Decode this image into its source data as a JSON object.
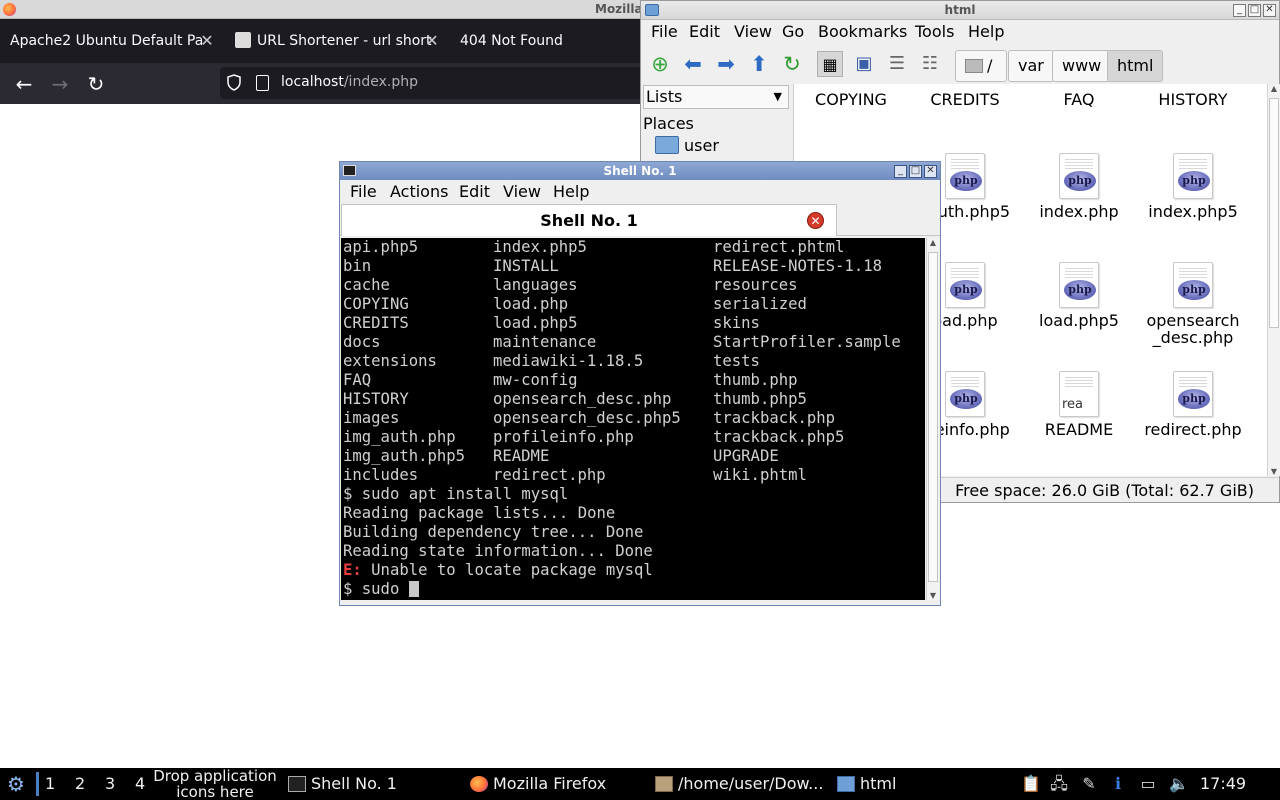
{
  "firefox": {
    "window_title": "Mozilla",
    "tabs": [
      {
        "label": "Apache2 Ubuntu Default Pa"
      },
      {
        "label": "URL Shortener - url short"
      },
      {
        "label": "404 Not Found"
      }
    ],
    "url": {
      "host": "localhost",
      "path": "/index.php"
    }
  },
  "file_manager": {
    "window_title": "html",
    "menu": [
      "File",
      "Edit",
      "View",
      "Go",
      "Bookmarks",
      "Tools",
      "Help"
    ],
    "breadcrumbs": [
      "/",
      "var",
      "www",
      "html"
    ],
    "side": {
      "view_select": "Lists",
      "places_label": "Places",
      "user_label": "user"
    },
    "items": [
      {
        "label": "COPYING"
      },
      {
        "label": "CREDITS"
      },
      {
        "label": "FAQ"
      },
      {
        "label": "HISTORY"
      },
      {
        "label": ""
      },
      {
        "label": "_auth.php5",
        "icon": "php"
      },
      {
        "label": "index.php",
        "icon": "php"
      },
      {
        "label": "index.php5",
        "icon": "php"
      },
      {
        "label": "oad.php",
        "icon": "php"
      },
      {
        "label": "load.php5",
        "icon": "php"
      },
      {
        "label": "opensearch_desc.php",
        "icon": "php"
      },
      {
        "label": "fileinfo.php",
        "icon": "php"
      },
      {
        "label": "README",
        "icon": "text"
      },
      {
        "label": "redirect.php",
        "icon": "php"
      }
    ],
    "icon_badge": "php",
    "readme_badge": "rea",
    "status": "Free space: 26.0 GiB (Total: 62.7 GiB)"
  },
  "shell": {
    "window_title": "Shell No. 1",
    "menu": [
      "File",
      "Actions",
      "Edit",
      "View",
      "Help"
    ],
    "tab_label": "Shell No. 1",
    "listing": [
      [
        "api.php5",
        "index.php5",
        "redirect.phtml"
      ],
      [
        "bin",
        "INSTALL",
        "RELEASE-NOTES-1.18"
      ],
      [
        "cache",
        "languages",
        "resources"
      ],
      [
        "COPYING",
        "load.php",
        "serialized"
      ],
      [
        "CREDITS",
        "load.php5",
        "skins"
      ],
      [
        "docs",
        "maintenance",
        "StartProfiler.sample"
      ],
      [
        "extensions",
        "mediawiki-1.18.5",
        "tests"
      ],
      [
        "FAQ",
        "mw-config",
        "thumb.php"
      ],
      [
        "HISTORY",
        "opensearch_desc.php",
        "thumb.php5"
      ],
      [
        "images",
        "opensearch_desc.php5",
        "trackback.php"
      ],
      [
        "img_auth.php",
        "profileinfo.php",
        "trackback.php5"
      ],
      [
        "img_auth.php5",
        "README",
        "UPGRADE"
      ],
      [
        "includes",
        "redirect.php",
        "wiki.phtml"
      ]
    ],
    "output": [
      "$ sudo apt install mysql",
      "Reading package lists... Done",
      "Building dependency tree... Done",
      "Reading state information... Done"
    ],
    "error": {
      "prefix": "E:",
      "message": " Unable to locate package mysql"
    },
    "prompt": "$ sudo "
  },
  "taskbar": {
    "desktops": [
      "1",
      "2",
      "3",
      "4"
    ],
    "drop_hint": "Drop application icons here",
    "tasks": [
      {
        "label": "Shell No. 1"
      },
      {
        "label": "Mozilla Firefox"
      },
      {
        "label": "/home/user/Dow..."
      },
      {
        "label": "html"
      }
    ],
    "clock": "17:49"
  },
  "colors": {
    "accent": "#4a7fc4",
    "error": "#e83d3d",
    "terminal_bg": "#000000",
    "firefox_chrome": "#1c1b22"
  }
}
